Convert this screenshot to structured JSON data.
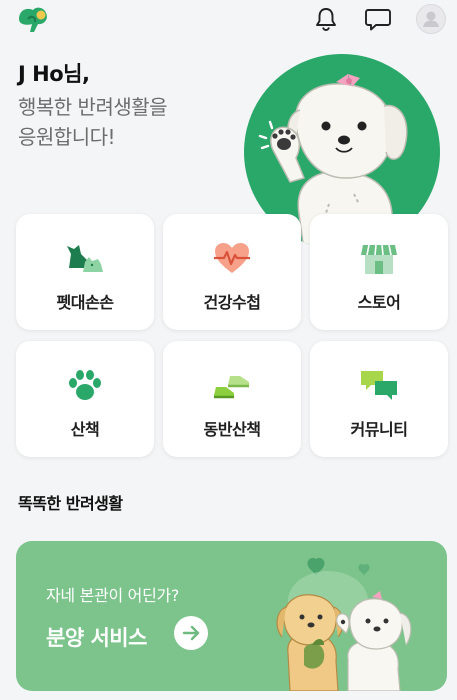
{
  "header": {
    "logo_icon": "leaf-logo-icon",
    "notification_icon": "bell-icon",
    "message_icon": "chat-bubble-icon",
    "profile_icon": "avatar"
  },
  "greeting": {
    "name": "J Ho님,",
    "line1": "행복한 반려생활을",
    "line2": "응원합니다!"
  },
  "menu": [
    {
      "label": "펫대손손",
      "icon": "pet-family-icon"
    },
    {
      "label": "건강수첩",
      "icon": "heart-pulse-icon"
    },
    {
      "label": "스토어",
      "icon": "store-icon"
    },
    {
      "label": "산책",
      "icon": "paw-icon"
    },
    {
      "label": "동반산책",
      "icon": "shoes-icon"
    },
    {
      "label": "커뮤니티",
      "icon": "speech-bubbles-icon"
    }
  ],
  "section": {
    "title": "똑똑한 반려생활"
  },
  "banner": {
    "subtitle": "자네 본관이 어딘가?",
    "title": "분양 서비스",
    "arrow_icon": "arrow-right-icon"
  },
  "colors": {
    "brand_green": "#2aa86a",
    "banner_green": "#7cc48b",
    "background": "#f4f5f6"
  }
}
